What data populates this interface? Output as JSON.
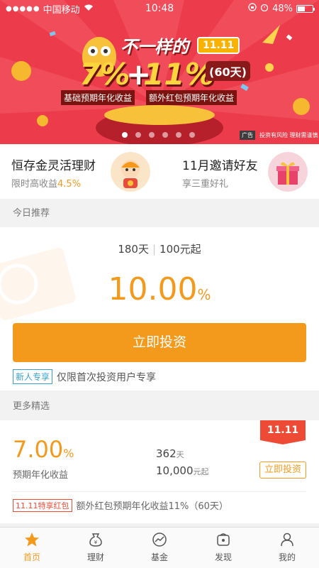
{
  "status_bar": {
    "carrier": "中国移动",
    "time": "10:48",
    "battery": "48%",
    "battery_level": 0.48
  },
  "banner": {
    "headline": "不一样的",
    "tag": "11.11",
    "rate1": "7%",
    "plus": "+",
    "rate2": "11%",
    "days": "(60天)",
    "sub1": "基础预期年化收益",
    "sub2": "额外红包预期年化收益",
    "ad_badge": "广告",
    "disclaimer": "投资有风险  理财需谨慎",
    "slide_count": 6,
    "active_slide": 0
  },
  "promos": [
    {
      "title": "恒存金灵活理财",
      "sub_prefix": "限时高收益",
      "sub_highlight": "4.5%"
    },
    {
      "title": "11月邀请好友",
      "sub_prefix": "享三重好礼",
      "sub_highlight": ""
    }
  ],
  "today": {
    "section_label": "今日推荐",
    "days": "180天",
    "min_amount": "100元起",
    "rate": "10.00",
    "rate_unit": "%",
    "button": "立即投资",
    "newbie_tag": "新人专享",
    "newbie_text": "仅限首次投资用户专享"
  },
  "more": {
    "section_label": "更多精选",
    "ribbon": "11.11",
    "rate": "7.00",
    "rate_unit": "%",
    "rate_label": "预期年化收益",
    "days": "362",
    "days_unit": "天",
    "min_amount": "10,000",
    "min_unit": "元起",
    "button": "立即投资",
    "bonus_tag": "11.11特享红包",
    "bonus_text": "额外红包预期年化收益11%（60天）"
  },
  "tabs": [
    {
      "label": "首页",
      "icon": "star-icon",
      "active": true
    },
    {
      "label": "理财",
      "icon": "money-bag-icon",
      "active": false
    },
    {
      "label": "基金",
      "icon": "chart-circle-icon",
      "active": false
    },
    {
      "label": "发现",
      "icon": "discover-box-icon",
      "active": false
    },
    {
      "label": "我的",
      "icon": "user-icon",
      "active": false
    }
  ],
  "colors": {
    "accent": "#f39a1d",
    "banner_red": "#ec3b4a",
    "ribbon_red": "#ee4b37",
    "tag_blue": "#3aa0c8"
  }
}
